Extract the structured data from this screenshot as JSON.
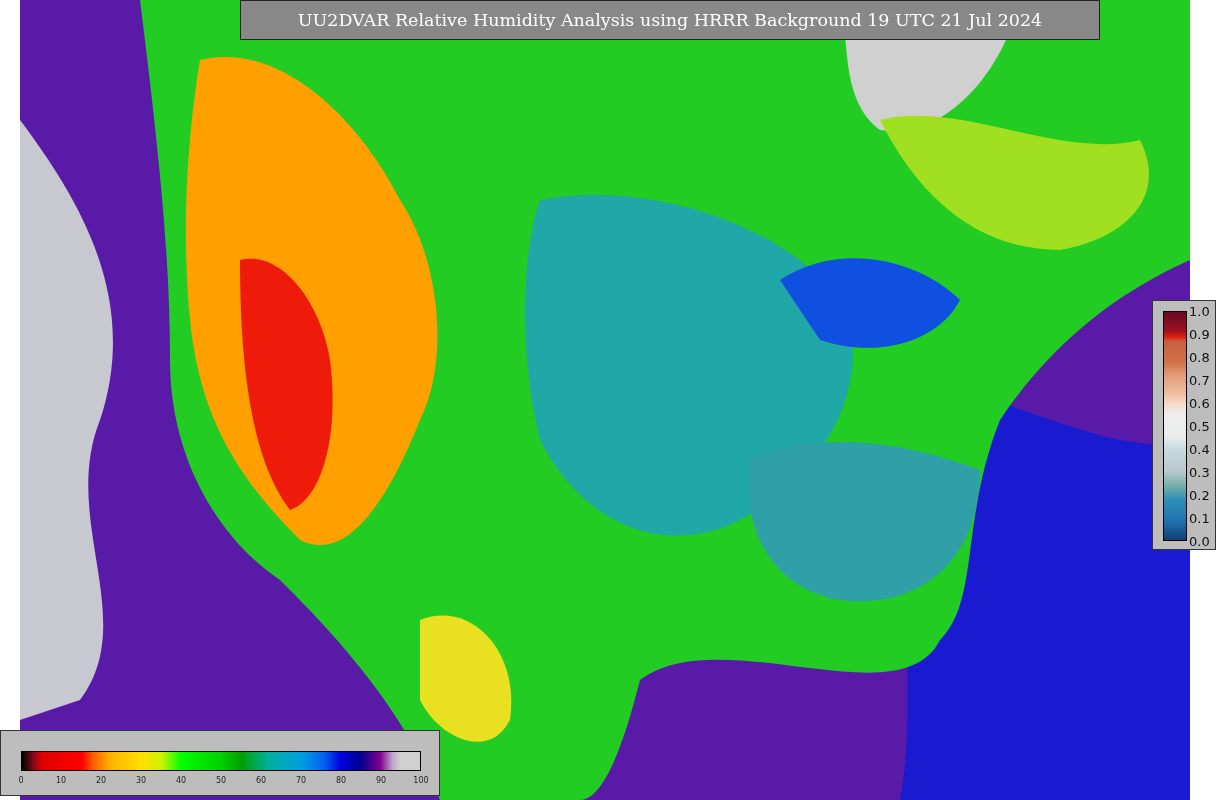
{
  "title": "UU2DVAR Relative Humidity Analysis using HRRR Background 19 UTC 21 Jul 2024",
  "humidity_scale": {
    "ticks": [
      "0",
      "10",
      "20",
      "30",
      "40",
      "50",
      "60",
      "70",
      "80",
      "90",
      "100"
    ]
  },
  "fraction_scale": {
    "ticks": [
      "1.0",
      "0.9",
      "0.8",
      "0.7",
      "0.6",
      "0.5",
      "0.4",
      "0.3",
      "0.2",
      "0.1",
      "0.0"
    ]
  }
}
